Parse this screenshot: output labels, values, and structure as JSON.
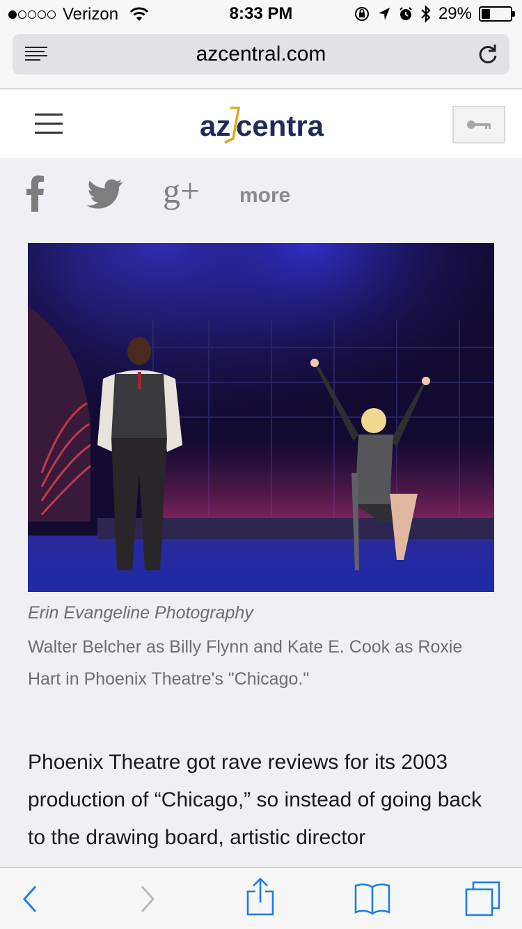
{
  "status_bar": {
    "carrier": "Verizon",
    "signal_bars_filled": 1,
    "signal_bars_total": 5,
    "time": "8:33 PM",
    "battery_percent": "29%",
    "battery_level": 0.29,
    "icons": [
      "wifi-icon",
      "orientation-lock-icon",
      "location-arrow-icon",
      "alarm-icon",
      "bluetooth-icon",
      "battery-icon"
    ]
  },
  "browser": {
    "url": "azcentral.com",
    "reader_icon": "reader-view-icon",
    "reload_icon": "reload-icon"
  },
  "site": {
    "logo_text_az": "az",
    "logo_text_central": "central",
    "menu_icon": "hamburger-menu-icon",
    "login_icon": "key-icon"
  },
  "share": {
    "icons": [
      "facebook-icon",
      "twitter-icon",
      "google-plus-icon"
    ],
    "gplus_label": "g+",
    "more_label": "more"
  },
  "photo": {
    "credit": "Erin Evangeline Photography",
    "caption": "Walter Belcher as Billy Flynn and Kate E. Cook as Roxie Hart in Phoenix Theatre's \"Chicago.\""
  },
  "article": {
    "text": "Phoenix Theatre got rave reviews for its 2003 production of “Chicago,” so instead of going back to the drawing board, artistic director"
  },
  "toolbar": {
    "icons": [
      "back-icon",
      "forward-icon",
      "share-icon",
      "bookmarks-icon",
      "tabs-icon"
    ]
  },
  "colors": {
    "ios_blue": "#1c7ee8",
    "logo_navy": "#1f2a5c",
    "logo_gold": "#e0a820",
    "page_bg": "#efeff4"
  }
}
